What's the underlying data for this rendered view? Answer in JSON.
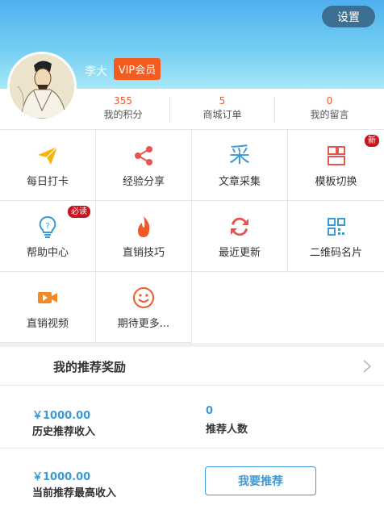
{
  "header": {
    "settings_label": "设置",
    "username": "李大",
    "vip_label": "VIP会员"
  },
  "stats": [
    {
      "value": "355",
      "label": "我的积分"
    },
    {
      "value": "5",
      "label": "商城订单"
    },
    {
      "value": "0",
      "label": "我的留言"
    }
  ],
  "menu": {
    "items": [
      {
        "label": "每日打卡",
        "icon": "paper-plane-icon"
      },
      {
        "label": "经验分享",
        "icon": "share-icon"
      },
      {
        "label": "文章采集",
        "icon": "collect-icon",
        "glyph": "采"
      },
      {
        "label": "模板切换",
        "icon": "template-icon",
        "badge": "新"
      },
      {
        "label": "帮助中心",
        "icon": "help-bulb-icon",
        "badge": "必读"
      },
      {
        "label": "直销技巧",
        "icon": "flame-icon"
      },
      {
        "label": "最近更新",
        "icon": "refresh-icon"
      },
      {
        "label": "二维码名片",
        "icon": "qrcode-icon"
      },
      {
        "label": "直销视频",
        "icon": "video-icon"
      },
      {
        "label": "期待更多...",
        "icon": "smile-icon"
      }
    ]
  },
  "reward": {
    "title": "我的推荐奖励",
    "history_amount": "￥1000.00",
    "history_label": "历史推荐收入",
    "count_value": "0",
    "count_label": "推荐人数",
    "current_amount": "￥1000.00",
    "current_label": "当前推荐最高收入",
    "recommend_button": "我要推荐"
  },
  "colors": {
    "accent": "#f05a28",
    "blue": "#3b9ad6",
    "badge": "#c8161e",
    "header_top": "#4fb0ef"
  }
}
